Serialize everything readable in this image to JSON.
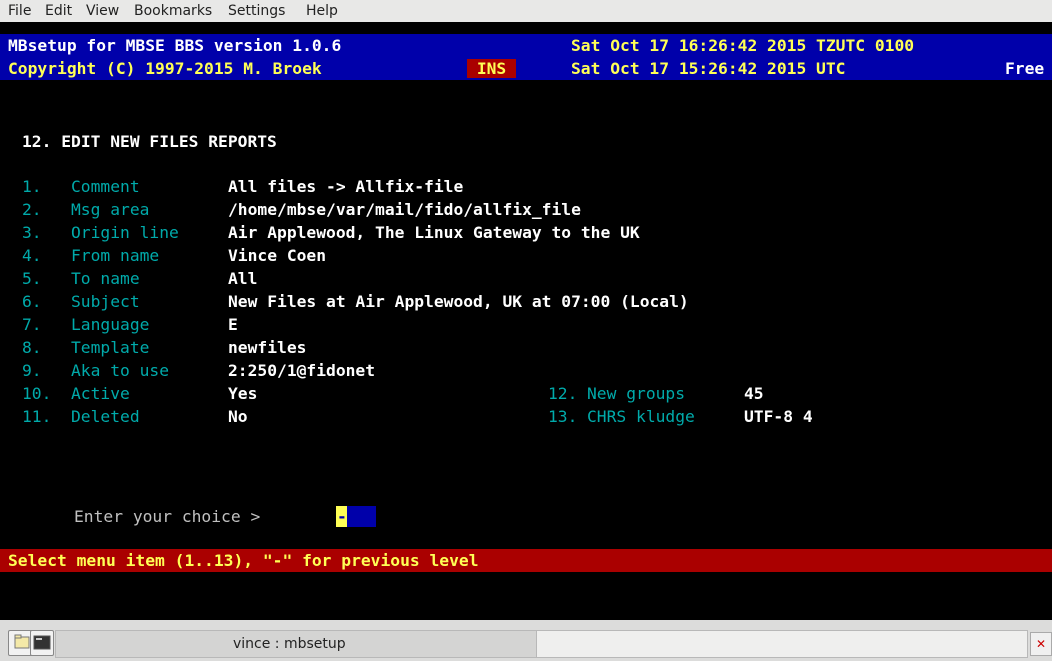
{
  "menu": [
    "File",
    "Edit",
    "View",
    "Bookmarks",
    "Settings",
    "Help"
  ],
  "header": {
    "title": "MBsetup for MBSE BBS version 1.0.6",
    "local_time": "Sat Oct 17 16:26:42 2015 TZUTC 0100",
    "copyright": "Copyright (C) 1997-2015 M. Broek",
    "mode": "INS",
    "utc_time": "Sat Oct 17 15:26:42 2015 UTC",
    "free": "Free"
  },
  "screen_title": "12. EDIT NEW FILES REPORTS",
  "fields": [
    {
      "num": "1.",
      "label": "Comment",
      "value": "All files -> Allfix-file"
    },
    {
      "num": "2.",
      "label": "Msg area",
      "value": "/home/mbse/var/mail/fido/allfix_file"
    },
    {
      "num": "3.",
      "label": "Origin line",
      "value": "Air Applewood, The Linux Gateway to the UK"
    },
    {
      "num": "4.",
      "label": "From name",
      "value": "Vince Coen"
    },
    {
      "num": "5.",
      "label": "To name",
      "value": "All"
    },
    {
      "num": "6.",
      "label": "Subject",
      "value": "New Files at Air Applewood, UK at 07:00 (Local)"
    },
    {
      "num": "7.",
      "label": "Language",
      "value": "E"
    },
    {
      "num": "8.",
      "label": "Template",
      "value": "newfiles"
    },
    {
      "num": "9.",
      "label": "Aka to use",
      "value": "2:250/1@fidonet"
    },
    {
      "num": "10.",
      "label": "Active",
      "value": "Yes"
    },
    {
      "num": "11.",
      "label": "Deleted",
      "value": "No"
    }
  ],
  "right_fields": [
    {
      "num": "12.",
      "label": "New groups",
      "value": "45"
    },
    {
      "num": "13.",
      "label": "CHRS kludge",
      "value": "UTF-8 4"
    }
  ],
  "prompt": "Enter your choice >",
  "input_value": "-",
  "status_line": "Select menu item (1..13), \"-\" for previous level",
  "taskbar": {
    "task_label": "vince : mbsetup"
  }
}
